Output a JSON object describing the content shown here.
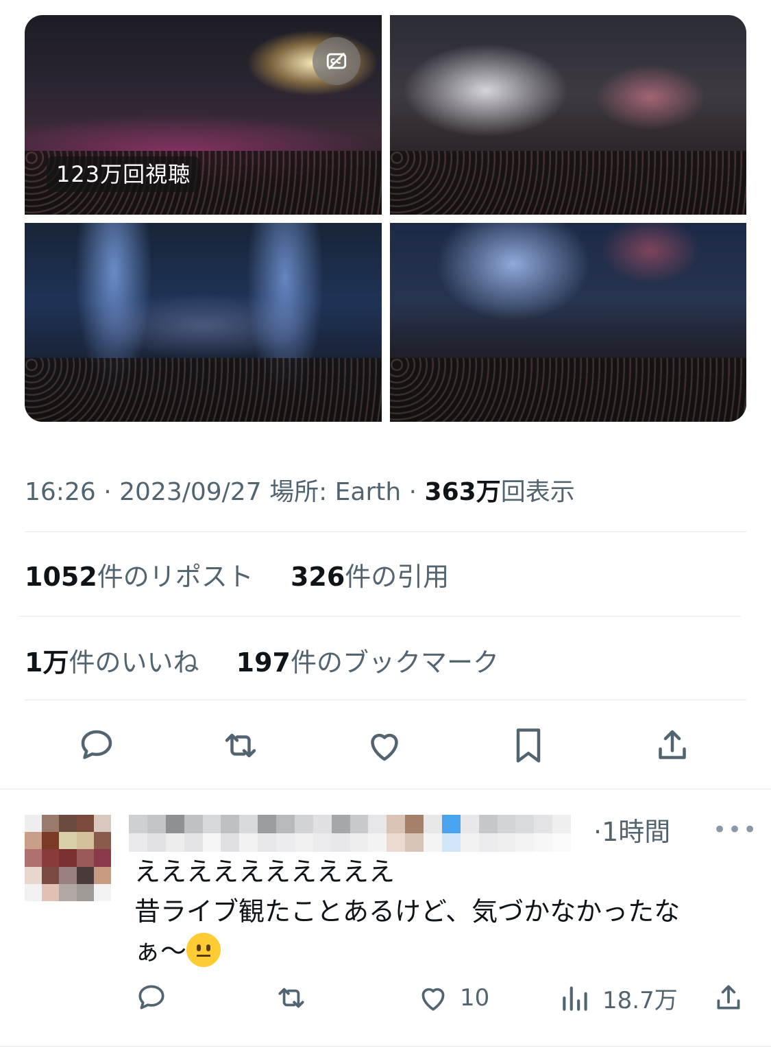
{
  "media": {
    "video_views_badge": "123万回視聴",
    "cc_icon": "closed-captions-off-icon"
  },
  "meta": {
    "time": "16:26",
    "sep1": "·",
    "date": "2023/09/27",
    "location": "場所: Earth",
    "sep2": "·",
    "views_number": "363万",
    "views_label": "回表示"
  },
  "stats": {
    "reposts_number": "1052",
    "reposts_label": "件のリポスト",
    "quotes_number": "326",
    "quotes_label": "件の引用",
    "likes_number": "1万",
    "likes_label": "件のいいね",
    "bookmarks_number": "197",
    "bookmarks_label": "件のブックマーク"
  },
  "actions": {
    "icons": [
      "reply-icon",
      "repost-icon",
      "like-icon",
      "bookmark-icon",
      "share-icon"
    ]
  },
  "reply": {
    "time": "·1時間",
    "more": "•••",
    "line1": "ええええええええええ",
    "line2": "昔ライブ観たことあるけど、気づかなかったな",
    "line3": "ぁ〜",
    "like_count": "10",
    "views_count": "18.7万"
  },
  "colors": {
    "text_primary": "#0f1419",
    "text_secondary": "#536471",
    "divider": "#e6e9ec"
  }
}
